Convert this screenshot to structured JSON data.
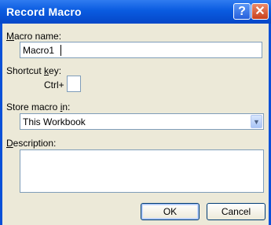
{
  "window": {
    "title": "Record Macro"
  },
  "title_buttons": {
    "help": "?",
    "close": "✕"
  },
  "macro_name": {
    "label_pre": "",
    "label_u": "M",
    "label_post": "acro name:",
    "value": "Macro1"
  },
  "shortcut": {
    "label_pre": "Shortcut ",
    "label_u": "k",
    "label_post": "ey:",
    "prefix": "Ctrl+",
    "value": ""
  },
  "store": {
    "label_pre": "Store macro ",
    "label_u": "i",
    "label_post": "n:",
    "selected": "This Workbook",
    "dropdown_icon": "chevron-down-icon"
  },
  "description": {
    "label_pre": "",
    "label_u": "D",
    "label_post": "escription:",
    "value": ""
  },
  "buttons": {
    "ok": "OK",
    "cancel": "Cancel"
  }
}
